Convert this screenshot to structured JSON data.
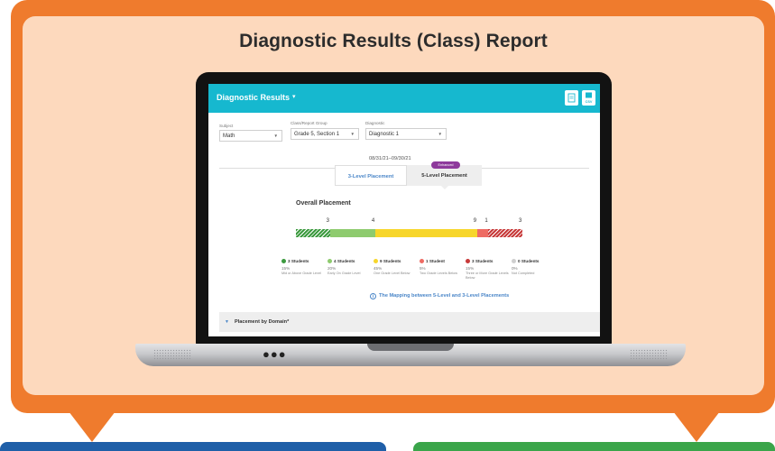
{
  "banner": {
    "title": "Diagnostic Results (Class) Report"
  },
  "app": {
    "title": "Diagnostic Results",
    "title_caret": "▾",
    "export_pdf_icon": "pdf-export-icon",
    "export_csv_icon": "csv-export-icon",
    "csv_icon_text": "CSV"
  },
  "filters": {
    "subject": {
      "label": "Subject",
      "value": "Math"
    },
    "group": {
      "label": "Class/Report Group",
      "value": "Grade 5, Section 1"
    },
    "diagnostic": {
      "label": "Diagnostic",
      "value": "Diagnostic 1",
      "date_range": "08/31/21–09/30/21"
    }
  },
  "tabs": {
    "three_level": "3-Level Placement",
    "five_level": "5-Level Placement",
    "enhanced_badge": "Enhanced",
    "active": "5-Level Placement"
  },
  "placement": {
    "title": "Overall Placement",
    "mapping_link": "The Mapping between 5-Level and 3-Level Placements",
    "mapping_icon": "info-icon",
    "segments": [
      {
        "count_label": "3",
        "count": 3,
        "color": "#3c9a3f",
        "pattern": "hatch"
      },
      {
        "count_label": "4",
        "count": 4,
        "color": "#8ecb6e",
        "pattern": "solid"
      },
      {
        "count_label": "9",
        "count": 9,
        "color": "#f7d62b",
        "pattern": "solid"
      },
      {
        "count_label": "1",
        "count": 1,
        "color": "#ee6b63",
        "pattern": "solid"
      },
      {
        "count_label": "3",
        "count": 3,
        "color": "#c73a3a",
        "pattern": "hatch"
      }
    ],
    "legend": [
      {
        "count_text": "3 Students",
        "percent": "15%",
        "desc": "Mid or Above Grade Level",
        "color": "#3c9a3f"
      },
      {
        "count_text": "4 Students",
        "percent": "20%",
        "desc": "Early On Grade Level",
        "color": "#8ecb6e"
      },
      {
        "count_text": "9 Students",
        "percent": "45%",
        "desc": "One Grade Level Below",
        "color": "#f7d62b"
      },
      {
        "count_text": "1 Student",
        "percent": "5%",
        "desc": "Two Grade Levels Below",
        "color": "#ee6b63"
      },
      {
        "count_text": "3 Students",
        "percent": "15%",
        "desc": "Three or More Grade Levels Below",
        "color": "#c73a3a"
      },
      {
        "count_text": "0 Students",
        "percent": "0%",
        "desc": "Not Completed",
        "color": "#cfcfcf"
      }
    ]
  },
  "domain_section": {
    "label": "Placement by Domain*",
    "toggle_icon": "chevron-down-icon"
  },
  "laptop": {
    "dots": "●●●"
  }
}
